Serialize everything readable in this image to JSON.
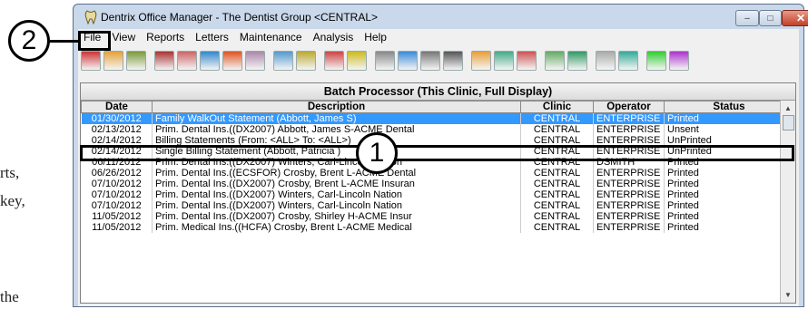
{
  "margin_text": [
    "rts,",
    "key,",
    "the"
  ],
  "window": {
    "title": "Dentrix Office Manager - The Dentist Group <CENTRAL>",
    "controls": {
      "minimize": "–",
      "maximize": "□",
      "close": "✕"
    }
  },
  "menu": [
    "File",
    "View",
    "Reports",
    "Letters",
    "Maintenance",
    "Analysis",
    "Help"
  ],
  "toolbar_icons": [
    "statement-icon",
    "report-icon",
    "note-icon",
    "book-icon",
    "pencil-icon",
    "edit-icon",
    "appointment-icon",
    "patient-icon",
    "mail-icon",
    "chart-icon",
    "calendar-icon",
    "dollar-icon",
    "insurance-icon",
    "monitor-icon",
    "printer-icon",
    "bin-icon",
    "refresh-icon",
    "help-icon",
    "query-icon",
    "people-icon",
    "transfer-icon",
    "tooth-icon",
    "graph-icon",
    "chat-icon",
    "sign-icon"
  ],
  "panel": {
    "title": "Batch Processor (This Clinic, Full Display)"
  },
  "columns": [
    "Date",
    "Description",
    "Clinic",
    "Operator",
    "Status"
  ],
  "rows": [
    {
      "date": "01/30/2012",
      "description": "Family WalkOut Statement (Abbott, James S)",
      "clinic": "CENTRAL",
      "operator": "ENTERPRISE",
      "status": "Printed",
      "selected": true
    },
    {
      "date": "02/13/2012",
      "description": "Prim. Dental Ins.((DX2007) Abbott, James S-ACME Dental",
      "clinic": "CENTRAL",
      "operator": "ENTERPRISE",
      "status": "Unsent"
    },
    {
      "date": "02/14/2012",
      "description": "Billing Statements (From: <ALL> To: <ALL>)",
      "clinic": "CENTRAL",
      "operator": "ENTERPRISE",
      "status": "UnPrinted"
    },
    {
      "date": "02/14/2012",
      "description": "Single Billing Statement (Abbott, Patricia )",
      "clinic": "CENTRAL",
      "operator": "ENTERPRISE",
      "status": "UnPrinted",
      "highlight": true
    },
    {
      "date": "06/11/2012",
      "description": "Prim. Dental Ins.((DX2007) Winters, Carl-Lincoln Nation",
      "clinic": "CENTRAL",
      "operator": "DSMITH",
      "status": "Printed"
    },
    {
      "date": "06/26/2012",
      "description": "Prim. Dental Ins.((ECSFOR) Crosby, Brent L-ACME Dental",
      "clinic": "CENTRAL",
      "operator": "ENTERPRISE",
      "status": "Printed"
    },
    {
      "date": "07/10/2012",
      "description": "Prim. Dental Ins.((DX2007) Crosby, Brent L-ACME Insuran",
      "clinic": "CENTRAL",
      "operator": "ENTERPRISE",
      "status": "Printed"
    },
    {
      "date": "07/10/2012",
      "description": "Prim. Dental Ins.((DX2007) Winters, Carl-Lincoln Nation",
      "clinic": "CENTRAL",
      "operator": "ENTERPRISE",
      "status": "Printed"
    },
    {
      "date": "07/10/2012",
      "description": "Prim. Dental Ins.((DX2007) Winters, Carl-Lincoln Nation",
      "clinic": "CENTRAL",
      "operator": "ENTERPRISE",
      "status": "Printed"
    },
    {
      "date": "11/05/2012",
      "description": "Prim. Dental Ins.((DX2007) Crosby, Shirley H-ACME Insur",
      "clinic": "CENTRAL",
      "operator": "ENTERPRISE",
      "status": "Printed"
    },
    {
      "date": "11/05/2012",
      "description": "Prim. Medical Ins.((HCFA) Crosby, Brent L-ACME Medical",
      "clinic": "CENTRAL",
      "operator": "ENTERPRISE",
      "status": "Printed"
    }
  ],
  "callouts": {
    "one": "1",
    "two": "2"
  }
}
